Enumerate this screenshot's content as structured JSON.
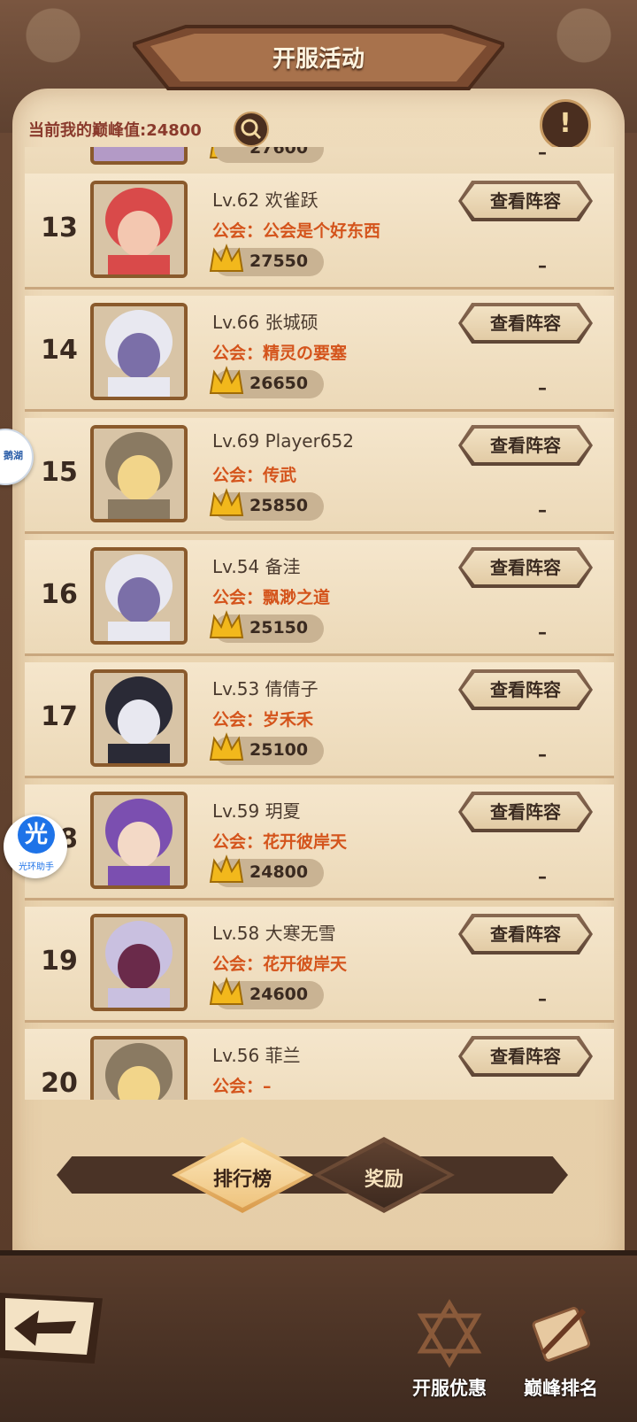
{
  "header": {
    "title": "开服活动",
    "peak_label": "当前我的巅峰值:24800"
  },
  "partial_row": {
    "score": "27600",
    "dash": "–"
  },
  "rows": [
    {
      "rank": "13",
      "level_name": "Lv.62 欢雀跃",
      "guild_label": "公会：",
      "guild": "公会是个好东西",
      "score": "27550",
      "dash": "–",
      "button": "查看阵容",
      "avatar": "red-haired-demon"
    },
    {
      "rank": "14",
      "level_name": "Lv.66 张城硕",
      "guild_label": "公会：",
      "guild": "精灵の要塞",
      "score": "26650",
      "dash": "–",
      "button": "查看阵容",
      "avatar": "white-haired-demon"
    },
    {
      "rank": "15",
      "level_name": "Lv.69 Player652",
      "guild_label": "公会：",
      "guild": "传武",
      "score": "25850",
      "dash": "–",
      "button": "查看阵容",
      "avatar": "hooded-blonde"
    },
    {
      "rank": "16",
      "level_name": "Lv.54 备洼",
      "guild_label": "公会：",
      "guild": "飘渺之道",
      "score": "25150",
      "dash": "–",
      "button": "查看阵容",
      "avatar": "white-haired-demon"
    },
    {
      "rank": "17",
      "level_name": "Lv.53 倩倩子",
      "guild_label": "公会：",
      "guild": "岁禾禾",
      "score": "25100",
      "dash": "–",
      "button": "查看阵容",
      "avatar": "dark-hooded"
    },
    {
      "rank": "18",
      "level_name": "Lv.59 玥夏",
      "guild_label": "公会：",
      "guild": "花开彼岸天",
      "score": "24800",
      "dash": "–",
      "button": "查看阵容",
      "avatar": "purple-haired-elf"
    },
    {
      "rank": "19",
      "level_name": "Lv.58 大寒无雪",
      "guild_label": "公会：",
      "guild": "花开彼岸天",
      "score": "24600",
      "dash": "–",
      "button": "查看阵容",
      "avatar": "silver-haired-vampire"
    },
    {
      "rank": "20",
      "level_name": "Lv.56 菲兰",
      "guild_label": "公会：",
      "guild": "–",
      "score": "",
      "dash": "",
      "button": "查看阵容",
      "avatar": "hooded-blonde"
    }
  ],
  "tabs": {
    "rank_label": "排行榜",
    "reward_label": "奖励"
  },
  "nav": {
    "offer_label": "开服优惠",
    "peak_rank_label": "巅峰排名"
  },
  "overlay": {
    "assistant_glyph": "光",
    "assistant_label": "光环助手",
    "left_badge": "鹅湖"
  },
  "colors": {
    "guild": "#d4541c",
    "peak_label": "#8a3a2c",
    "parchment": "#efdcbc"
  }
}
